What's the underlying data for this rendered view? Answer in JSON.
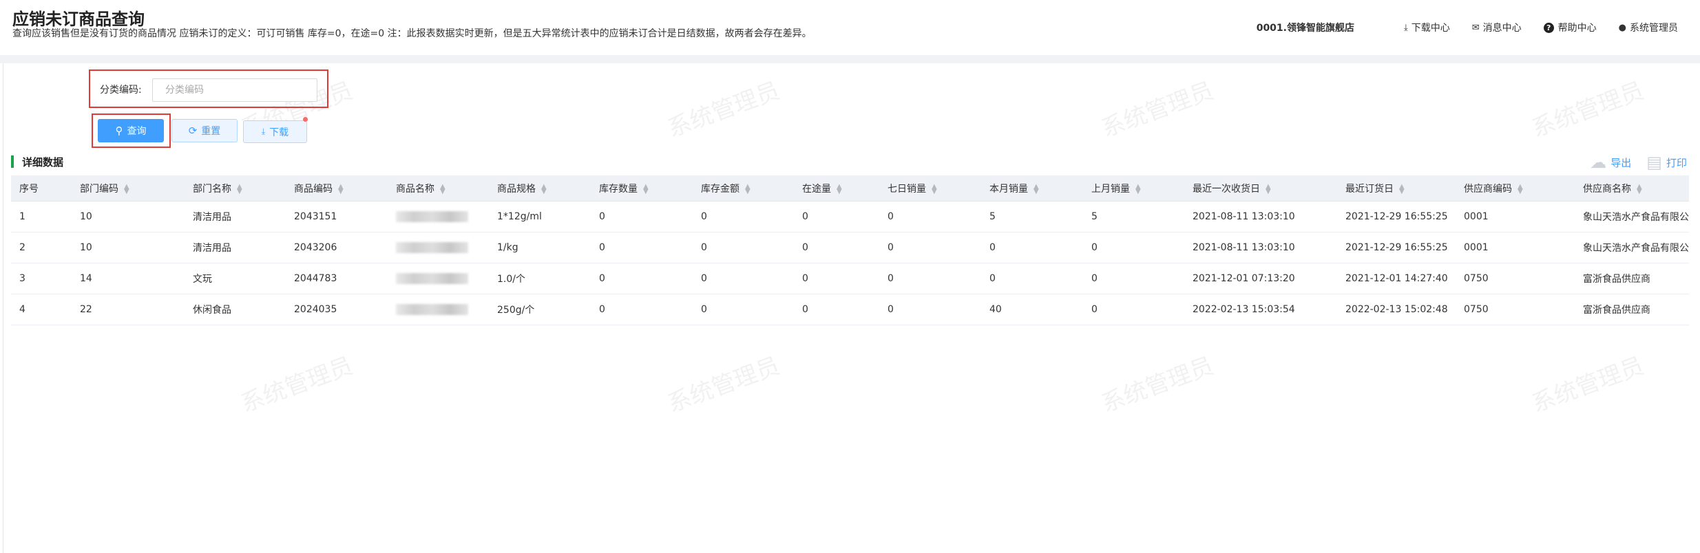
{
  "header": {
    "title": "应销未订商品查询",
    "description": "查询应该销售但是没有订货的商品情况 应销未订的定义：可订可销售 库存=0，在途=0 注：此报表数据实时更新，但是五大异常统计表中的应销未订合计是日结数据，故两者会存在差异。",
    "store": "0001.领锋智能旗舰店",
    "links": {
      "download_center": "下载中心",
      "message_center": "消息中心",
      "help_center": "帮助中心",
      "user": "系统管理员"
    }
  },
  "filter": {
    "label": "分类编码:",
    "placeholder": "分类编码",
    "value": ""
  },
  "buttons": {
    "query": "查询",
    "reset": "重置",
    "download": "下载"
  },
  "section": {
    "title": "详细数据",
    "export": "导出",
    "print": "打印"
  },
  "table": {
    "columns": [
      "序号",
      "部门编码",
      "部门名称",
      "商品编码",
      "商品名称",
      "商品规格",
      "库存数量",
      "库存金额",
      "在途量",
      "七日销量",
      "本月销量",
      "上月销量",
      "最近一次收货日",
      "最近订货日",
      "供应商编码",
      "供应商名称"
    ],
    "rows": [
      {
        "no": "1",
        "dept_code": "10",
        "dept_name": "清洁用品",
        "goods_code": "2043151",
        "goods_name": "",
        "spec": "1*12g/ml",
        "stock_qty": "0",
        "stock_amt": "0",
        "in_transit": "0",
        "sales_7d": "0",
        "sales_month": "5",
        "sales_last_month": "5",
        "last_receive": "2021-08-11 13:03:10",
        "last_order": "2021-12-29 16:55:25",
        "supplier_code": "0001",
        "supplier_name": "象山天浩水产食品有限公"
      },
      {
        "no": "2",
        "dept_code": "10",
        "dept_name": "清洁用品",
        "goods_code": "2043206",
        "goods_name": "",
        "spec": "1/kg",
        "stock_qty": "0",
        "stock_amt": "0",
        "in_transit": "0",
        "sales_7d": "0",
        "sales_month": "0",
        "sales_last_month": "0",
        "last_receive": "2021-08-11 13:03:10",
        "last_order": "2021-12-29 16:55:25",
        "supplier_code": "0001",
        "supplier_name": "象山天浩水产食品有限公"
      },
      {
        "no": "3",
        "dept_code": "14",
        "dept_name": "文玩",
        "goods_code": "2044783",
        "goods_name": "",
        "spec": "1.0/个",
        "stock_qty": "0",
        "stock_amt": "0",
        "in_transit": "0",
        "sales_7d": "0",
        "sales_month": "0",
        "sales_last_month": "0",
        "last_receive": "2021-12-01 07:13:20",
        "last_order": "2021-12-01 14:27:40",
        "supplier_code": "0750",
        "supplier_name": "富浙食品供应商"
      },
      {
        "no": "4",
        "dept_code": "22",
        "dept_name": "休闲食品",
        "goods_code": "2024035",
        "goods_name": "",
        "spec": "250g/个",
        "stock_qty": "0",
        "stock_amt": "0",
        "in_transit": "0",
        "sales_7d": "0",
        "sales_month": "40",
        "sales_last_month": "0",
        "last_receive": "2022-02-13 15:03:54",
        "last_order": "2022-02-13 15:02:48",
        "supplier_code": "0750",
        "supplier_name": "富浙食品供应商"
      }
    ]
  },
  "watermark": "系统管理员"
}
